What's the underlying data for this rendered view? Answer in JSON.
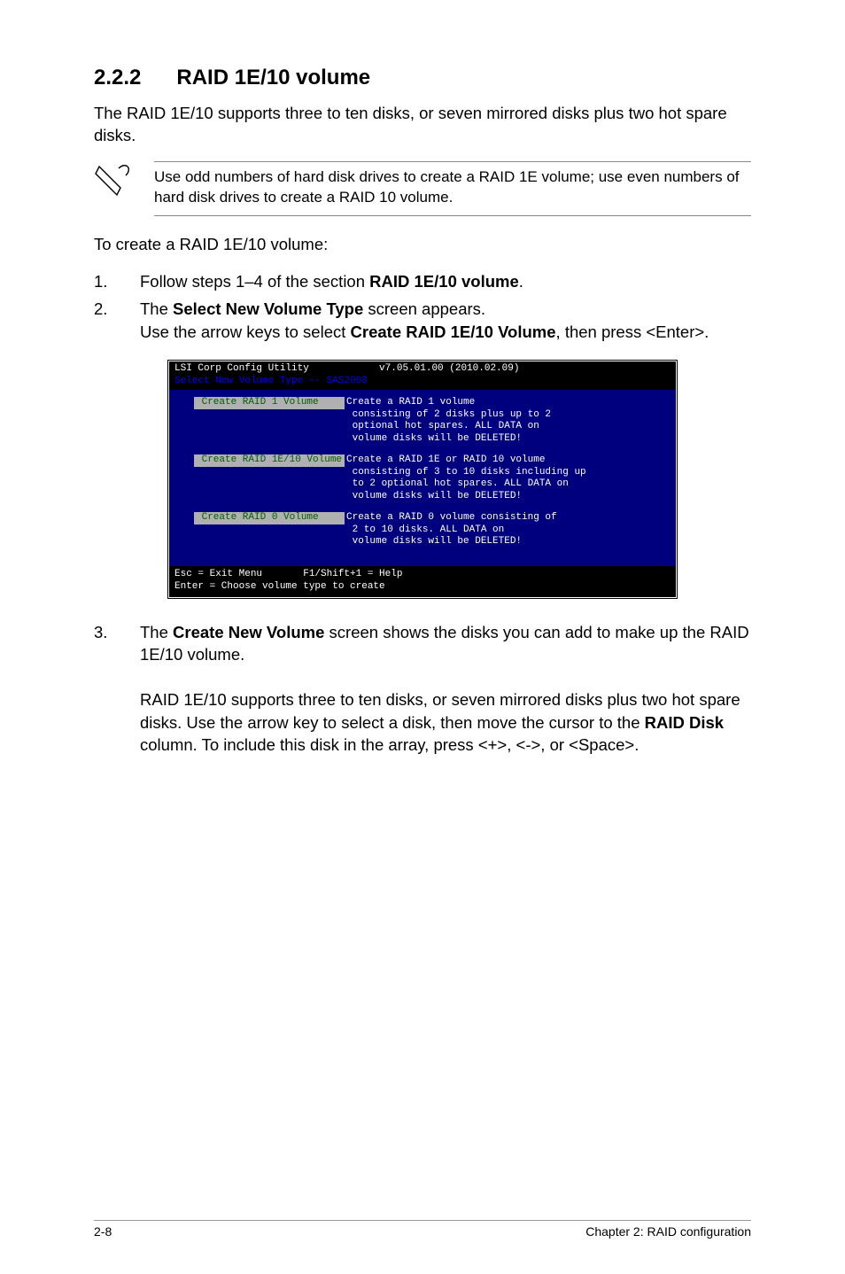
{
  "heading": {
    "num": "2.2.2",
    "title": "RAID 1E/10 volume"
  },
  "intro": "The RAID 1E/10 supports three to ten disks, or seven mirrored disks plus two hot spare disks.",
  "note": "Use odd numbers of hard disk drives to create a RAID 1E volume; use even numbers of hard disk drives to create a RAID 10 volume.",
  "lead": "To create a RAID 1E/10 volume:",
  "step1": {
    "num": "1.",
    "pre": "Follow steps 1–4 of the section ",
    "bold": "RAID 1E/10 volume",
    "post": "."
  },
  "step2": {
    "num": "2.",
    "l1a": "The ",
    "l1b": "Select New Volume Type",
    "l1c": " screen appears.",
    "l2a": "Use the arrow keys to select ",
    "l2b": "Create RAID 1E/10 Volume",
    "l2c": ", then press <Enter>."
  },
  "terminal": {
    "title": "LSI Corp Config Utility            v7.05.01.00 (2010.02.09)",
    "subtitle": "Select New Volume Type -- SAS2008",
    "options": [
      {
        "label": " Create RAID 1 Volume    ",
        "desc": "Create a RAID 1 volume\n consisting of 2 disks plus up to 2\n optional hot spares. ALL DATA on\n volume disks will be DELETED!"
      },
      {
        "label": " Create RAID 1E/10 Volume",
        "desc": "Create a RAID 1E or RAID 10 volume\n consisting of 3 to 10 disks including up\n to 2 optional hot spares. ALL DATA on\n volume disks will be DELETED!"
      },
      {
        "label": " Create RAID 0 Volume    ",
        "desc": "Create a RAID 0 volume consisting of\n 2 to 10 disks. ALL DATA on\n volume disks will be DELETED!"
      }
    ],
    "footer": "Esc = Exit Menu       F1/Shift+1 = Help\nEnter = Choose volume type to create"
  },
  "step3": {
    "num": "3.",
    "p1a": "The ",
    "p1b": "Create New Volume",
    "p1c": " screen shows the disks you can add to make up the RAID 1E/10 volume.",
    "p2a": "RAID 1E/10 supports three to ten disks, or seven mirrored disks plus two hot spare disks. Use the arrow key to select a disk, then move the cursor to the ",
    "p2b": "RAID Disk",
    "p2c": " column. To include this disk in the array, press <+>, <->, or <Space>."
  },
  "footer": {
    "left": "2-8",
    "right": "Chapter 2: RAID configuration"
  }
}
